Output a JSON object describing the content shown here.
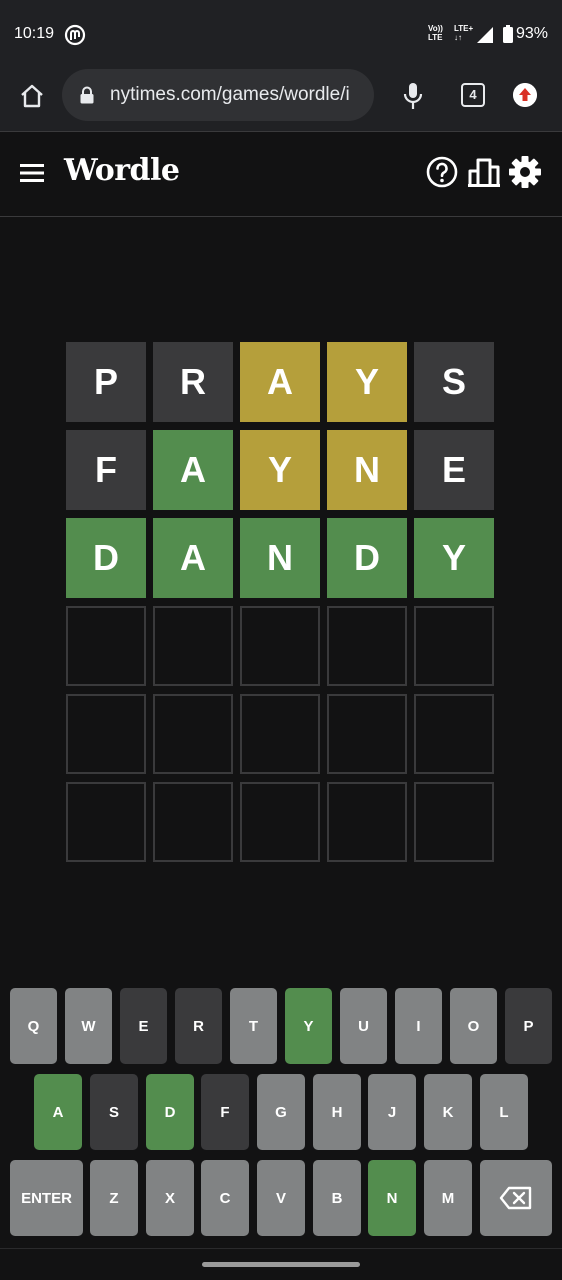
{
  "status_bar": {
    "time": "10:19",
    "volte_line1": "Vo))",
    "volte_line2": "LTE",
    "lte_line1": "LTE+",
    "lte_line2": "↓↑",
    "battery": "93%"
  },
  "browser": {
    "url": "nytimes.com/games/wordle/i",
    "tab_count": "4"
  },
  "header": {
    "title": "Wordle"
  },
  "board": [
    [
      {
        "letter": "P",
        "state": "absent"
      },
      {
        "letter": "R",
        "state": "absent"
      },
      {
        "letter": "A",
        "state": "present"
      },
      {
        "letter": "Y",
        "state": "present"
      },
      {
        "letter": "S",
        "state": "absent"
      }
    ],
    [
      {
        "letter": "F",
        "state": "absent"
      },
      {
        "letter": "A",
        "state": "correct"
      },
      {
        "letter": "Y",
        "state": "present"
      },
      {
        "letter": "N",
        "state": "present"
      },
      {
        "letter": "E",
        "state": "absent"
      }
    ],
    [
      {
        "letter": "D",
        "state": "correct"
      },
      {
        "letter": "A",
        "state": "correct"
      },
      {
        "letter": "N",
        "state": "correct"
      },
      {
        "letter": "D",
        "state": "correct"
      },
      {
        "letter": "Y",
        "state": "correct"
      }
    ],
    [
      {
        "letter": "",
        "state": "empty"
      },
      {
        "letter": "",
        "state": "empty"
      },
      {
        "letter": "",
        "state": "empty"
      },
      {
        "letter": "",
        "state": "empty"
      },
      {
        "letter": "",
        "state": "empty"
      }
    ],
    [
      {
        "letter": "",
        "state": "empty"
      },
      {
        "letter": "",
        "state": "empty"
      },
      {
        "letter": "",
        "state": "empty"
      },
      {
        "letter": "",
        "state": "empty"
      },
      {
        "letter": "",
        "state": "empty"
      }
    ],
    [
      {
        "letter": "",
        "state": "empty"
      },
      {
        "letter": "",
        "state": "empty"
      },
      {
        "letter": "",
        "state": "empty"
      },
      {
        "letter": "",
        "state": "empty"
      },
      {
        "letter": "",
        "state": "empty"
      }
    ]
  ],
  "keyboard": [
    [
      {
        "label": "Q",
        "state": "unused"
      },
      {
        "label": "W",
        "state": "unused"
      },
      {
        "label": "E",
        "state": "absent"
      },
      {
        "label": "R",
        "state": "absent"
      },
      {
        "label": "T",
        "state": "unused"
      },
      {
        "label": "Y",
        "state": "correct"
      },
      {
        "label": "U",
        "state": "unused"
      },
      {
        "label": "I",
        "state": "unused"
      },
      {
        "label": "O",
        "state": "unused"
      },
      {
        "label": "P",
        "state": "absent"
      }
    ],
    [
      {
        "label": "A",
        "state": "correct"
      },
      {
        "label": "S",
        "state": "absent"
      },
      {
        "label": "D",
        "state": "correct"
      },
      {
        "label": "F",
        "state": "absent"
      },
      {
        "label": "G",
        "state": "unused"
      },
      {
        "label": "H",
        "state": "unused"
      },
      {
        "label": "J",
        "state": "unused"
      },
      {
        "label": "K",
        "state": "unused"
      },
      {
        "label": "L",
        "state": "unused"
      }
    ],
    [
      {
        "label": "ENTER",
        "state": "unused"
      },
      {
        "label": "Z",
        "state": "unused"
      },
      {
        "label": "X",
        "state": "unused"
      },
      {
        "label": "C",
        "state": "unused"
      },
      {
        "label": "V",
        "state": "unused"
      },
      {
        "label": "B",
        "state": "unused"
      },
      {
        "label": "N",
        "state": "correct"
      },
      {
        "label": "M",
        "state": "unused"
      },
      {
        "label": "",
        "icon": "backspace-icon",
        "state": "unused"
      }
    ]
  ],
  "colors": {
    "correct": "#538d4e",
    "present": "#b59f3b",
    "absent": "#3a3a3c",
    "unused_key": "#818384",
    "background": "#121213"
  }
}
